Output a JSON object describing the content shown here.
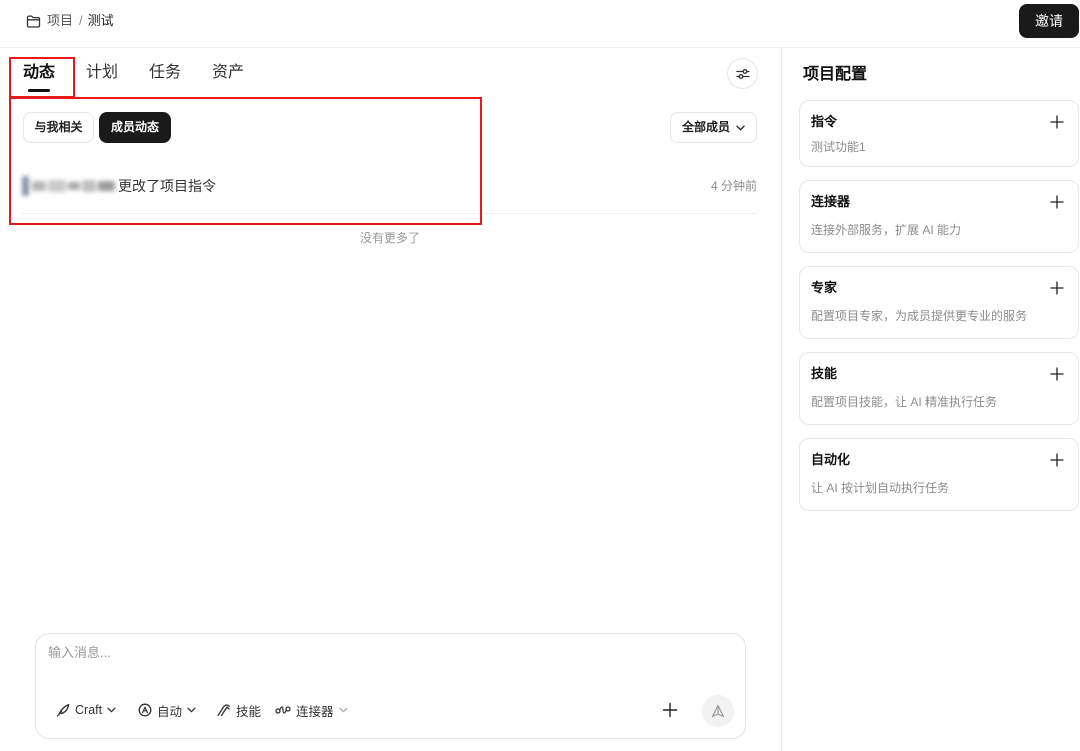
{
  "header": {
    "breadcrumb": [
      "项目",
      "测试"
    ],
    "separator": "/",
    "invite_label": "邀请"
  },
  "tabs": [
    {
      "label": "动态",
      "active": true
    },
    {
      "label": "计划",
      "active": false
    },
    {
      "label": "任务",
      "active": false
    },
    {
      "label": "资产",
      "active": false
    }
  ],
  "feed_filters": {
    "scope_options": [
      {
        "label": "与我相关",
        "selected": false
      },
      {
        "label": "成员动态",
        "selected": true
      }
    ],
    "member_select": {
      "value": "全部成员"
    }
  },
  "activity": [
    {
      "action": "更改了项目指令",
      "time": "4 分钟前"
    }
  ],
  "feed_end_text": "没有更多了",
  "composer": {
    "placeholder": "输入消息...",
    "model_label": "Craft",
    "mode_label": "自动",
    "skills_label": "技能",
    "connectors_label": "连接器"
  },
  "config_panel": {
    "title": "项目配置",
    "cards": [
      {
        "title": "指令",
        "description": "测试功能1"
      },
      {
        "title": "连接器",
        "description": "连接外部服务，扩展 AI 能力"
      },
      {
        "title": "专家",
        "description": "配置项目专家，为成员提供更专业的服务"
      },
      {
        "title": "技能",
        "description": "配置项目技能，让 AI 精准执行任务"
      },
      {
        "title": "自动化",
        "description": "让 AI 按计划自动执行任务"
      }
    ]
  },
  "icons": {
    "breadcrumb": "folder-icon",
    "feed_settings": "sliders-icon",
    "dropdown": "chevron-down-icon",
    "model": "feather-icon",
    "mode": "auto-mode-icon",
    "skills": "skills-icon",
    "connectors": "connector-icon",
    "add": "plus-icon",
    "send": "send-icon"
  },
  "colors": {
    "primary": "#1a1a1a",
    "border": "#e6e6e6",
    "muted_text": "#8c8c8c",
    "annotation_highlight": "#e8191c"
  }
}
